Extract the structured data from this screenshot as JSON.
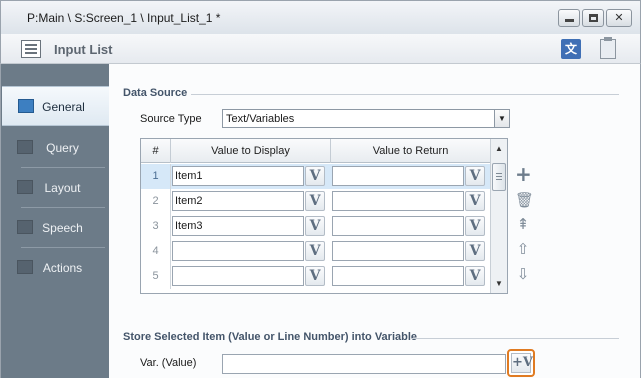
{
  "window": {
    "title": "P:Main \\ S:Screen_1 \\ Input_List_1 *"
  },
  "header": {
    "title": "Input List"
  },
  "sidebar": {
    "items": [
      {
        "label": "General",
        "active": true
      },
      {
        "label": "Query",
        "active": false
      },
      {
        "label": "Layout",
        "active": false
      },
      {
        "label": "Speech",
        "active": false
      },
      {
        "label": "Actions",
        "active": false
      }
    ]
  },
  "data_source": {
    "group_label": "Data Source",
    "source_type_label": "Source Type",
    "source_type_value": "Text/Variables",
    "table": {
      "columns": [
        "#",
        "Value to Display",
        "Value to Return"
      ],
      "rows": [
        {
          "num": "1",
          "display": "Item1",
          "return": ""
        },
        {
          "num": "2",
          "display": "Item2",
          "return": ""
        },
        {
          "num": "3",
          "display": "Item3",
          "return": ""
        },
        {
          "num": "4",
          "display": "",
          "return": ""
        },
        {
          "num": "5",
          "display": "",
          "return": ""
        }
      ],
      "selected_row": 0,
      "var_button_label": "V"
    }
  },
  "store": {
    "group_label": "Store Selected Item (Value or Line Number) into Variable",
    "var_label": "Var. (Value)",
    "var_value": "",
    "var_button_label": "+V"
  },
  "colors": {
    "sidebar_bg": "#6c7b88",
    "selected_row": "#d6e8f8",
    "highlight_border": "#e07b22"
  }
}
